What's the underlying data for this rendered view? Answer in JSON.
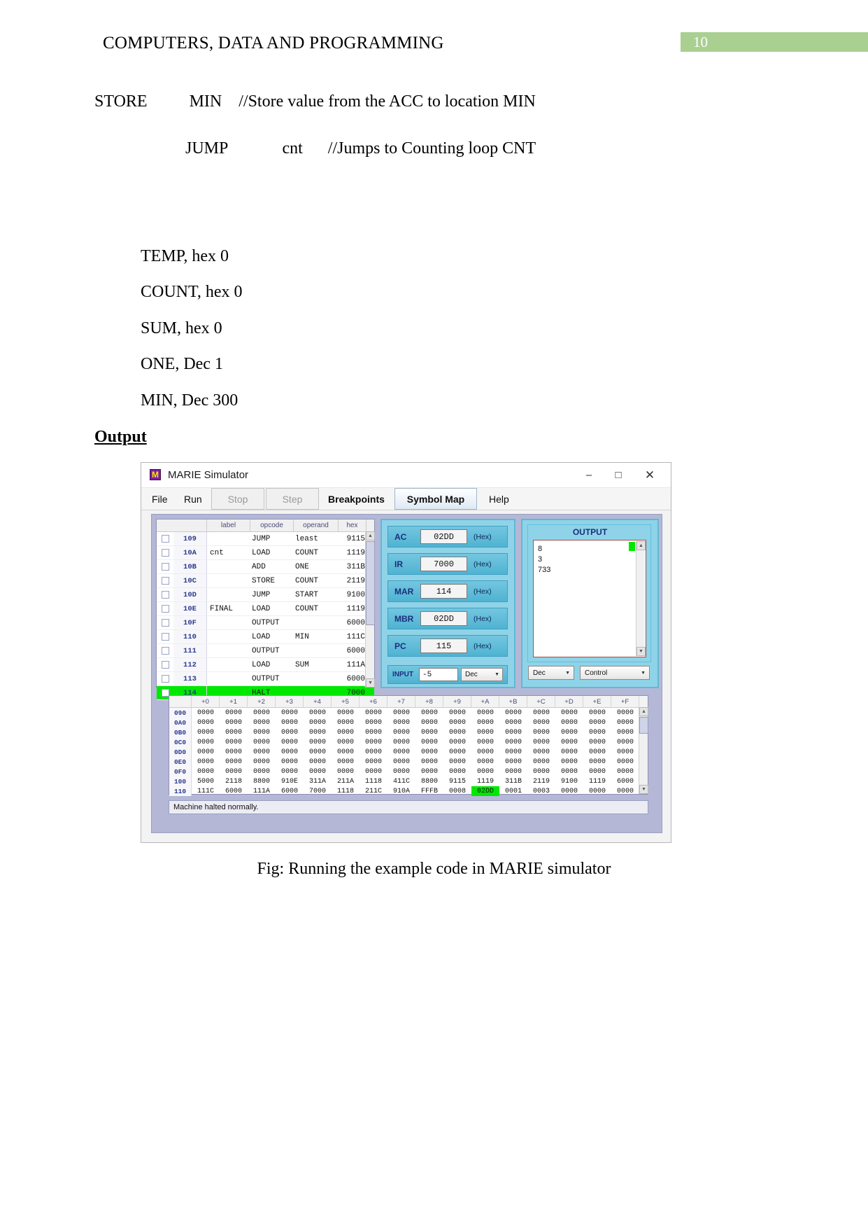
{
  "document": {
    "header_title": "COMPUTERS, DATA AND PROGRAMMING",
    "page_number": "10",
    "page_badge_color": "#a9cf91",
    "lines": {
      "store": "STORE          MIN    //Store value from the ACC to location MIN",
      "jump": "JUMP             cnt      //Jumps to Counting loop CNT"
    },
    "variables": [
      "TEMP, hex 0",
      "COUNT, hex 0",
      "SUM, hex 0",
      "ONE, Dec 1",
      "MIN, Dec 300"
    ],
    "output_heading": "Output",
    "figure_caption": "Fig: Running the example code in MARIE simulator"
  },
  "simulator": {
    "title": "MARIE Simulator",
    "icon": "M",
    "window_controls": {
      "minimize": "–",
      "maximize": "□",
      "close": "✕"
    },
    "menu": [
      {
        "label": "File",
        "accel": "F",
        "state": "normal"
      },
      {
        "label": "Run",
        "accel": "R",
        "state": "normal"
      },
      {
        "label": "Stop",
        "accel": "S",
        "state": "disabled"
      },
      {
        "label": "Step",
        "accel": "t",
        "state": "disabled"
      },
      {
        "label": "Breakpoints",
        "accel": "B",
        "state": "normal"
      },
      {
        "label": "Symbol Map",
        "accel": "m",
        "state": "active"
      },
      {
        "label": "Help",
        "accel": "H",
        "state": "normal"
      }
    ],
    "code_listing": {
      "columns": [
        "",
        "",
        "label",
        "opcode",
        "operand",
        "hex"
      ],
      "rows": [
        {
          "addr": "109",
          "label": "",
          "opcode": "JUMP",
          "operand": "least",
          "hex": "9115",
          "highlight": false
        },
        {
          "addr": "10A",
          "label": "cnt",
          "opcode": "LOAD",
          "operand": "COUNT",
          "hex": "1119",
          "highlight": false
        },
        {
          "addr": "10B",
          "label": "",
          "opcode": "ADD",
          "operand": "ONE",
          "hex": "311B",
          "highlight": false
        },
        {
          "addr": "10C",
          "label": "",
          "opcode": "STORE",
          "operand": "COUNT",
          "hex": "2119",
          "highlight": false
        },
        {
          "addr": "10D",
          "label": "",
          "opcode": "JUMP",
          "operand": "START",
          "hex": "9100",
          "highlight": false
        },
        {
          "addr": "10E",
          "label": "FINAL",
          "opcode": "LOAD",
          "operand": "COUNT",
          "hex": "1119",
          "highlight": false
        },
        {
          "addr": "10F",
          "label": "",
          "opcode": "OUTPUT",
          "operand": "",
          "hex": "6000",
          "highlight": false
        },
        {
          "addr": "110",
          "label": "",
          "opcode": "LOAD",
          "operand": "MIN",
          "hex": "111C",
          "highlight": false
        },
        {
          "addr": "111",
          "label": "",
          "opcode": "OUTPUT",
          "operand": "",
          "hex": "6000",
          "highlight": false
        },
        {
          "addr": "112",
          "label": "",
          "opcode": "LOAD",
          "operand": "SUM",
          "hex": "111A",
          "highlight": false
        },
        {
          "addr": "113",
          "label": "",
          "opcode": "OUTPUT",
          "operand": "",
          "hex": "6000",
          "highlight": false
        },
        {
          "addr": "114",
          "label": "",
          "opcode": "HALT",
          "operand": "",
          "hex": "7000",
          "highlight": true
        }
      ]
    },
    "registers": [
      {
        "name": "AC",
        "value": "02DD",
        "unit": "(Hex)"
      },
      {
        "name": "IR",
        "value": "7000",
        "unit": "(Hex)"
      },
      {
        "name": "MAR",
        "value": "114",
        "unit": "(Hex)"
      },
      {
        "name": "MBR",
        "value": "02DD",
        "unit": "(Hex)"
      },
      {
        "name": "PC",
        "value": "115",
        "unit": "(Hex)"
      }
    ],
    "input": {
      "label": "INPUT",
      "value": "-5",
      "base": "Dec"
    },
    "output": {
      "title": "OUTPUT",
      "lines": [
        "8",
        "3",
        "733"
      ],
      "base_select": "Dec",
      "control_select": "Control"
    },
    "memory": {
      "columns": [
        "+0",
        "+1",
        "+2",
        "+3",
        "+4",
        "+5",
        "+6",
        "+7",
        "+8",
        "+9",
        "+A",
        "+B",
        "+C",
        "+D",
        "+E",
        "+F"
      ],
      "rows": [
        {
          "addr": "090",
          "cells": [
            "0000",
            "0000",
            "0000",
            "0000",
            "0000",
            "0000",
            "0000",
            "0000",
            "0000",
            "0000",
            "0000",
            "0000",
            "0000",
            "0000",
            "0000",
            "0000"
          ],
          "highlight": -1
        },
        {
          "addr": "0A0",
          "cells": [
            "0000",
            "0000",
            "0000",
            "0000",
            "0000",
            "0000",
            "0000",
            "0000",
            "0000",
            "0000",
            "0000",
            "0000",
            "0000",
            "0000",
            "0000",
            "0000"
          ],
          "highlight": -1
        },
        {
          "addr": "0B0",
          "cells": [
            "0000",
            "0000",
            "0000",
            "0000",
            "0000",
            "0000",
            "0000",
            "0000",
            "0000",
            "0000",
            "0000",
            "0000",
            "0000",
            "0000",
            "0000",
            "0000"
          ],
          "highlight": -1
        },
        {
          "addr": "0C0",
          "cells": [
            "0000",
            "0000",
            "0000",
            "0000",
            "0000",
            "0000",
            "0000",
            "0000",
            "0000",
            "0000",
            "0000",
            "0000",
            "0000",
            "0000",
            "0000",
            "0000"
          ],
          "highlight": -1
        },
        {
          "addr": "0D0",
          "cells": [
            "0000",
            "0000",
            "0000",
            "0000",
            "0000",
            "0000",
            "0000",
            "0000",
            "0000",
            "0000",
            "0000",
            "0000",
            "0000",
            "0000",
            "0000",
            "0000"
          ],
          "highlight": -1
        },
        {
          "addr": "0E0",
          "cells": [
            "0000",
            "0000",
            "0000",
            "0000",
            "0000",
            "0000",
            "0000",
            "0000",
            "0000",
            "0000",
            "0000",
            "0000",
            "0000",
            "0000",
            "0000",
            "0000"
          ],
          "highlight": -1
        },
        {
          "addr": "0F0",
          "cells": [
            "0000",
            "0000",
            "0000",
            "0000",
            "0000",
            "0000",
            "0000",
            "0000",
            "0000",
            "0000",
            "0000",
            "0000",
            "0000",
            "0000",
            "0000",
            "0000"
          ],
          "highlight": -1
        },
        {
          "addr": "100",
          "cells": [
            "5000",
            "2118",
            "8800",
            "910E",
            "311A",
            "211A",
            "1118",
            "411C",
            "8800",
            "9115",
            "1119",
            "311B",
            "2119",
            "9100",
            "1119",
            "6000"
          ],
          "highlight": -1
        },
        {
          "addr": "110",
          "cells": [
            "111C",
            "6000",
            "111A",
            "6000",
            "7000",
            "1118",
            "211C",
            "910A",
            "FFFB",
            "0008",
            "02DD",
            "0001",
            "0003",
            "0000",
            "0000",
            "0000"
          ],
          "highlight": 10
        }
      ]
    },
    "status_bar": "Machine halted normally."
  }
}
